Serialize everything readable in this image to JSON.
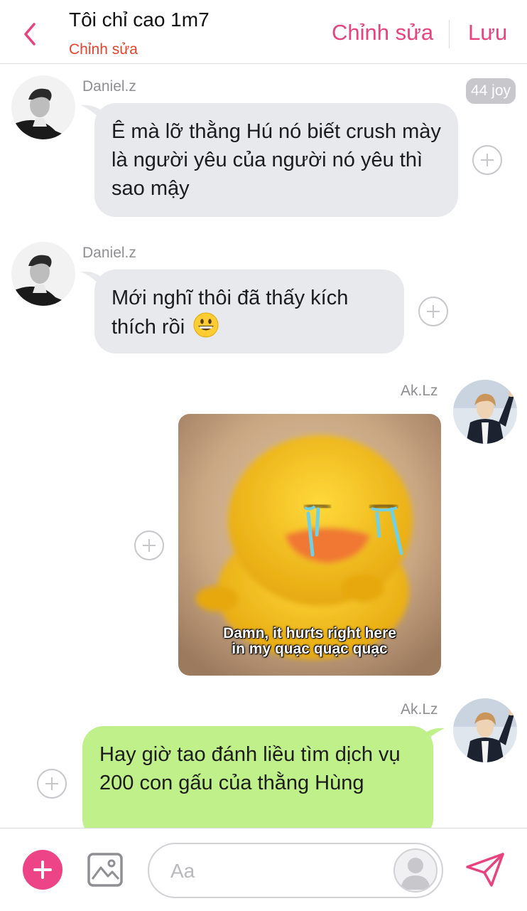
{
  "header": {
    "title": "Tôi chỉ cao 1m7",
    "subtitle": "Chỉnh sửa",
    "edit_label": "Chỉnh sửa",
    "save_label": "Lưu",
    "accent_color": "#e8437f",
    "subtitle_color": "#e5432a"
  },
  "messages": [
    {
      "direction": "incoming",
      "sender": "Daniel.z",
      "text": "Ê mà lỡ thằng Hú nó biết crush mày là người yêu của người nó yêu thì sao mậy",
      "reaction_badge": "44 joy"
    },
    {
      "direction": "incoming",
      "sender": "Daniel.z",
      "text": "Mới nghĩ thôi đã thấy kích thích rồi",
      "emoji": "grinning-face"
    },
    {
      "direction": "outgoing",
      "sender": "Ak.Lz",
      "type": "sticker",
      "sticker_name": "crying-duck",
      "caption_line1": "Damn, it hurts right here",
      "caption_line2": "in my quạc quạc quạc"
    },
    {
      "direction": "outgoing",
      "sender": "Ak.Lz",
      "text": "Hay giờ tao đánh liều tìm dịch vụ 200 con gấu của thằng Hùng"
    }
  ],
  "composer": {
    "placeholder": "Aa",
    "icons": [
      "plus-icon",
      "image-icon",
      "avatar-icon",
      "send-icon"
    ]
  },
  "colors": {
    "incoming_bubble": "#e8e9ec",
    "outgoing_bubble": "#bff08a",
    "plus_button": "#ec4486"
  }
}
